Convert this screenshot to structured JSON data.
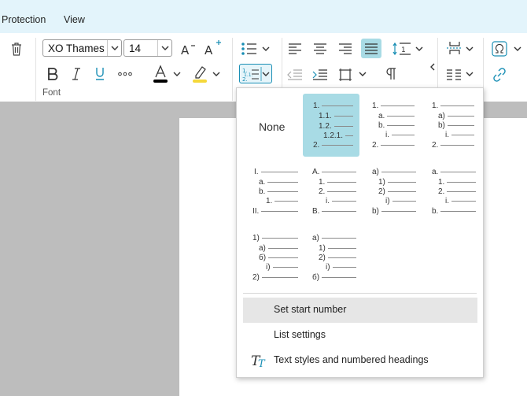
{
  "menu": {
    "protection": "Protection",
    "view": "View"
  },
  "font_group": {
    "font_name": "XO Thames",
    "font_size": "14",
    "label": "Font"
  },
  "colors": {
    "accent": "#1a8fb5",
    "active_tile": "#a8dbe5",
    "font_color": "#000000",
    "highlight_color": "#f5d83a",
    "menubar_bg": "#e3f4fb"
  },
  "numbering_dropdown": {
    "none_label": "None",
    "styles": [
      {
        "lines": [
          "1.",
          "1.1.",
          "1.2.",
          "1.2.1.",
          "2."
        ]
      },
      {
        "lines": [
          "1.",
          "a.",
          "b.",
          "i.",
          "2."
        ]
      },
      {
        "lines": [
          "1.",
          "a)",
          "b)",
          "i.",
          "2."
        ]
      },
      {
        "lines": [
          "I.",
          "a.",
          "b.",
          "1.",
          "II."
        ]
      },
      {
        "lines": [
          "A.",
          "1.",
          "2.",
          "i.",
          "B."
        ]
      },
      {
        "lines": [
          "a)",
          "1)",
          "2)",
          "i)",
          "b)"
        ]
      },
      {
        "lines": [
          "a.",
          "1.",
          "2.",
          "i.",
          "b."
        ]
      },
      {
        "lines": [
          "1)",
          "a)",
          "б)",
          "i)",
          "2)"
        ]
      },
      {
        "lines": [
          "а)",
          "1)",
          "2)",
          "i)",
          "б)"
        ]
      }
    ],
    "items": {
      "set_start": "Set start number",
      "list_settings": "List settings",
      "text_styles": "Text styles and numbered headings"
    },
    "text_styles_icon_text": "TT"
  }
}
